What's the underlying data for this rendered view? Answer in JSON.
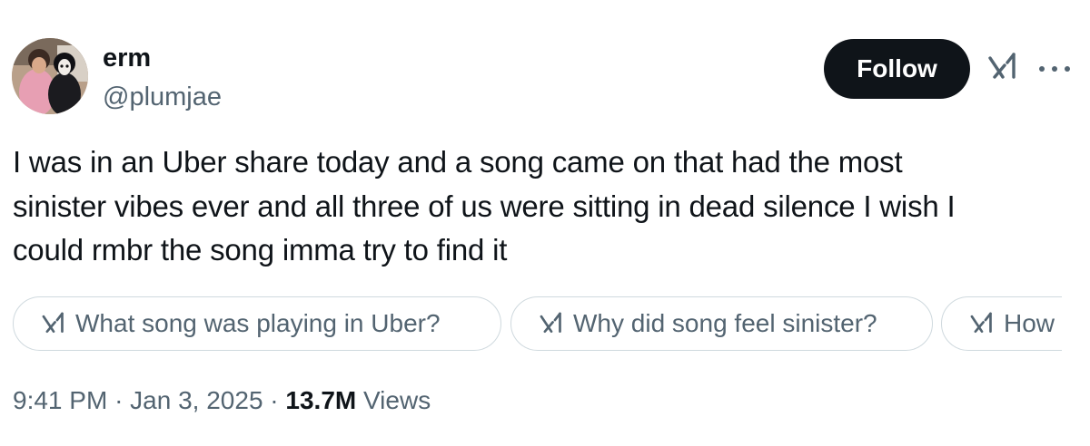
{
  "author": {
    "display_name": "erm",
    "handle": "@plumjae"
  },
  "actions": {
    "follow_label": "Follow",
    "grok_icon": "grok-icon",
    "more_icon": "more-icon"
  },
  "tweet": {
    "text_lines": [
      "I was in an Uber share today and a song came on that had the most",
      "sinister vibes ever and all three of us were sitting in dead silence I wish I",
      "could rmbr the song imma try to find it"
    ]
  },
  "suggestions": [
    {
      "label": "What song was playing in Uber?"
    },
    {
      "label": "Why did song feel sinister?"
    },
    {
      "label": "How"
    }
  ],
  "meta": {
    "time": "9:41 PM",
    "separator": "·",
    "date": "Jan 3, 2025",
    "views_count": "13.7M",
    "views_label": "Views"
  },
  "colors": {
    "text_primary": "#0f1419",
    "text_secondary": "#536471",
    "button_bg": "#0f1419",
    "border": "#cfd9de"
  }
}
